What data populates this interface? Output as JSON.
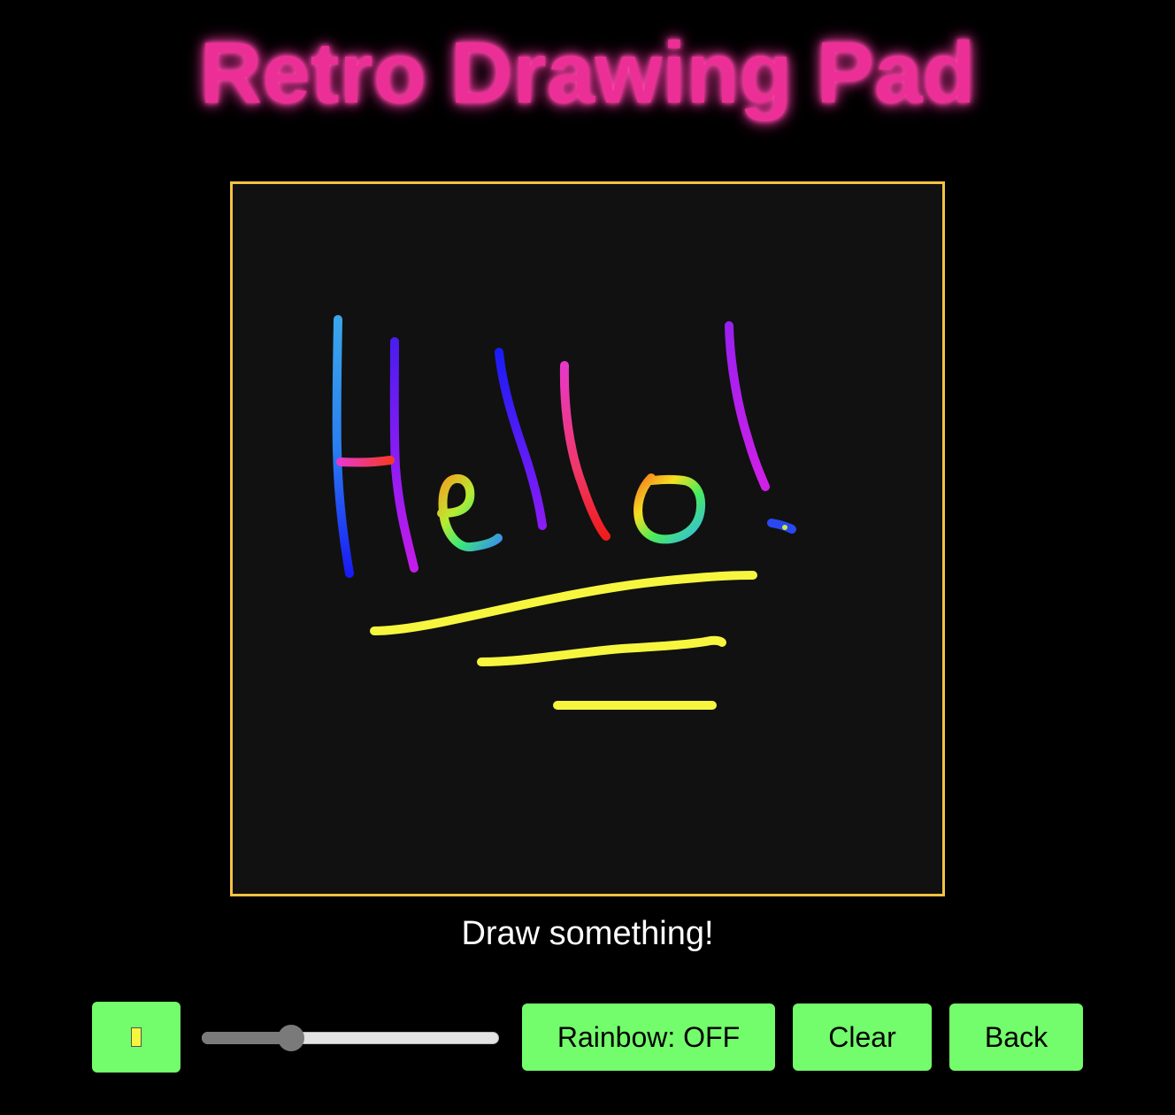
{
  "app": {
    "title": "Retro Drawing Pad",
    "caption": "Draw something!"
  },
  "canvas": {
    "background": "#111111",
    "border_color": "#f5c242"
  },
  "toolbar": {
    "color_value": "#f7f63f",
    "brush_size_fraction": 0.3,
    "rainbow_label": "Rainbow: OFF",
    "clear_label": "Clear",
    "back_label": "Back"
  },
  "theme": {
    "title_color": "#ec2f96",
    "button_color": "#73fc6b"
  }
}
